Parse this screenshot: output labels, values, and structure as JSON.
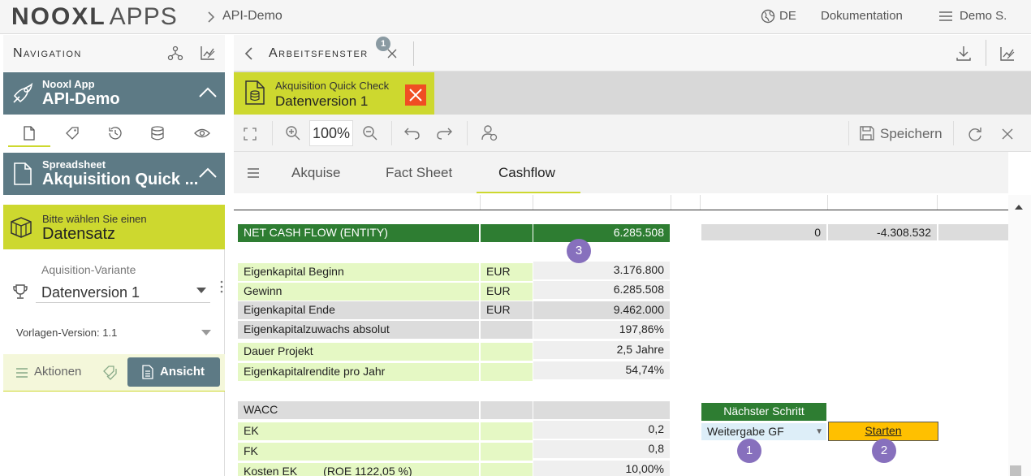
{
  "header": {
    "logo_main": "NOOXL",
    "logo_sub": "APPS",
    "breadcrumb": "API-Demo",
    "language": "DE",
    "docs": "Dokumentation",
    "user": "Demo S."
  },
  "navigation": {
    "title": "Navigation",
    "app_caption": "Nooxl App",
    "app_name": "API-Demo",
    "spreadsheet_caption": "Spreadsheet",
    "spreadsheet_name": "Akquisition Quick ...",
    "dataset_prompt": "Bitte wählen Sie einen",
    "dataset_label": "Datensatz",
    "variant_label": "Aquisition-Variante",
    "variant_value": "Datenversion 1",
    "template_version": "Vorlagen-Version: 1.1",
    "actions_label": "Aktionen",
    "view_button": "Ansicht"
  },
  "workspace": {
    "title": "Arbeitsfenster",
    "window_count": "1",
    "tab_caption": "Akquisition Quick Check",
    "tab_name": "Datenversion 1",
    "zoom": "100%",
    "save_label": "Speichern",
    "sheet_tabs": [
      "Akquise",
      "Fact Sheet",
      "Cashflow"
    ],
    "active_sheet": "Cashflow"
  },
  "sheet": {
    "ncf_label": "NET CASH FLOW (ENTITY)",
    "ncf_value": "6.285.508",
    "ncf_right1": "0",
    "ncf_right2": "-4.308.532",
    "rows": [
      {
        "label": "Eigenkapital Beginn",
        "unit": "EUR",
        "value": "3.176.800"
      },
      {
        "label": "Gewinn",
        "unit": "EUR",
        "value": "6.285.508"
      },
      {
        "label": "Eigenkapital Ende",
        "unit": "EUR",
        "value": "9.462.000"
      },
      {
        "label": "Eigenkapitalzuwachs absolut",
        "unit": "",
        "value": "197,86%"
      },
      {
        "label": "Dauer Projekt",
        "unit": "",
        "value": "2,5 Jahre"
      },
      {
        "label": "Eigenkapitalrendite pro Jahr",
        "unit": "",
        "value": "54,74%"
      }
    ],
    "wacc_label": "WACC",
    "wacc_rows": [
      {
        "label": "EK",
        "value": "0,2"
      },
      {
        "label": "FK",
        "value": "0,8"
      },
      {
        "label": "Kosten EK",
        "extra": "(ROE 1122,05 %)",
        "value": "10,00%"
      }
    ],
    "next_step_label": "Nächster Schritt",
    "next_step_value": "Weitergabe GF",
    "start_button": "Starten",
    "markers": [
      "1",
      "2",
      "3"
    ]
  },
  "colors": {
    "brand_green": "#cdd82f",
    "slate": "#5d7a85",
    "sheet_green": "#2e7d32",
    "marker": "#8770bd",
    "start_button": "#ffc000",
    "close_red": "#f04e23"
  }
}
